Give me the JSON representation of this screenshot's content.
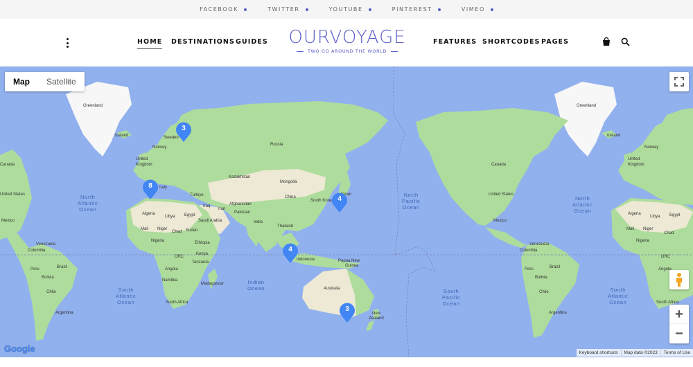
{
  "social": [
    {
      "label": "FACEBOOK"
    },
    {
      "label": "TWITTER"
    },
    {
      "label": "YOUTUBE"
    },
    {
      "label": "PINTEREST"
    },
    {
      "label": "VIMEO"
    }
  ],
  "nav_left": [
    "HOME",
    "DESTINATIONS",
    "GUIDES"
  ],
  "nav_right": [
    "FEATURES",
    "SHORTCODES",
    "PAGES"
  ],
  "logo": {
    "title": "OURVOYAGE",
    "tagline": "TWO GO AROUND THE WORLD"
  },
  "map": {
    "type_control": {
      "map": "Map",
      "satellite": "Satellite",
      "selected": "Map"
    },
    "clusters": {
      "scandinavia": "3",
      "spain": "8",
      "japan": "4",
      "indonesia": "4",
      "australia": "3"
    },
    "countries": {
      "greenland_left": "Greenland",
      "greenland_right": "Greenland",
      "iceland_left": "Iceland",
      "iceland_right": "Iceland",
      "sweden": "Sweden",
      "norway_left": "Norway",
      "norway_right": "Norway",
      "uk_left": "United",
      "uk_left2": "Kingdom",
      "uk_right": "United",
      "uk_right2": "Kingdom",
      "russia": "Russia",
      "kazakhstan": "Kazakhstan",
      "mongolia": "Mongolia",
      "china": "China",
      "south_korea": "South Korea",
      "japan": "Japan",
      "turkiye": "Türkiye",
      "iraq": "Iraq",
      "iran": "Iran",
      "afghanistan": "Afghanistan",
      "pakistan": "Pakistan",
      "india": "India",
      "thailand": "Thailand",
      "saudi_arabia": "Saudi Arabia",
      "italy": "Italy",
      "algeria_left": "Algeria",
      "libya_left": "Libya",
      "egypt_left": "Egypt",
      "mali_left": "Mali",
      "niger_left": "Niger",
      "chad_left": "Chad",
      "sudan": "Sudan",
      "nigeria_left": "Nigeria",
      "ethiopia": "Ethiopia",
      "drc_left": "DRC",
      "kenya": "Kenya",
      "tanzania": "Tanzania",
      "angola_left": "Angola",
      "namibia_left": "Namibia",
      "south_africa_left": "South Africa",
      "madagascar": "Madagascar",
      "indonesia": "Indonesia",
      "papua_new_guinea": "Papua New",
      "papua_new_guinea2": "Guinea",
      "australia": "Australia",
      "new_zealand": "New",
      "new_zealand2": "Zealand",
      "canada_left": "Canada",
      "canada_right": "Canada",
      "united_states_left": "United States",
      "united_states_right": "United States",
      "mexico_left": "Mexico",
      "mexico_right": "Mexico",
      "colombia_left": "Colombia",
      "colombia_right": "Colombia",
      "venezuela_left": "Venezuela",
      "venezuela_right": "Venezuela",
      "peru_left": "Peru",
      "peru_right": "Peru",
      "brazil_left": "Brazil",
      "brazil_right": "Brazil",
      "bolivia_left": "Bolivia",
      "bolivia_right": "Bolivia",
      "chile_left": "Chile",
      "chile_right": "Chile",
      "argentina_left": "Argentina",
      "argentina_right": "Argentina",
      "algeria_right": "Algeria",
      "libya_right": "Libya",
      "egypt_right": "Egypt",
      "mali_right": "Mali",
      "niger_right": "Niger",
      "chad_right": "Chad",
      "nigeria_right": "Nigeria",
      "drc_right": "DRC",
      "angola_right": "Angola",
      "south_africa_right": "South Africa"
    },
    "oceans": {
      "north_atlantic_left": "North\nAtlantic\nOcean",
      "north_pacific": "North\nPacific\nOcean",
      "north_atlantic_right": "North\nAtlantic\nOcean",
      "south_atlantic_left": "South\nAtlantic\nOcean",
      "indian": "Indian\nOcean",
      "south_pacific": "South\nPacific\nOcean",
      "south_atlantic_right": "South\nAtlantic\nOcean"
    },
    "attribution": {
      "shortcuts": "Keyboard shortcuts",
      "data": "Map data ©2023",
      "terms": "Terms of Use"
    },
    "logo_text": "Google",
    "zoom_in": "+",
    "zoom_out": "−"
  },
  "colors": {
    "accent": "#5b5fc7",
    "water": "#91b1ee",
    "land": "#aedc9c",
    "desert": "#ede9d5",
    "ice": "#f7f7f7",
    "pin": "#4285f4"
  }
}
